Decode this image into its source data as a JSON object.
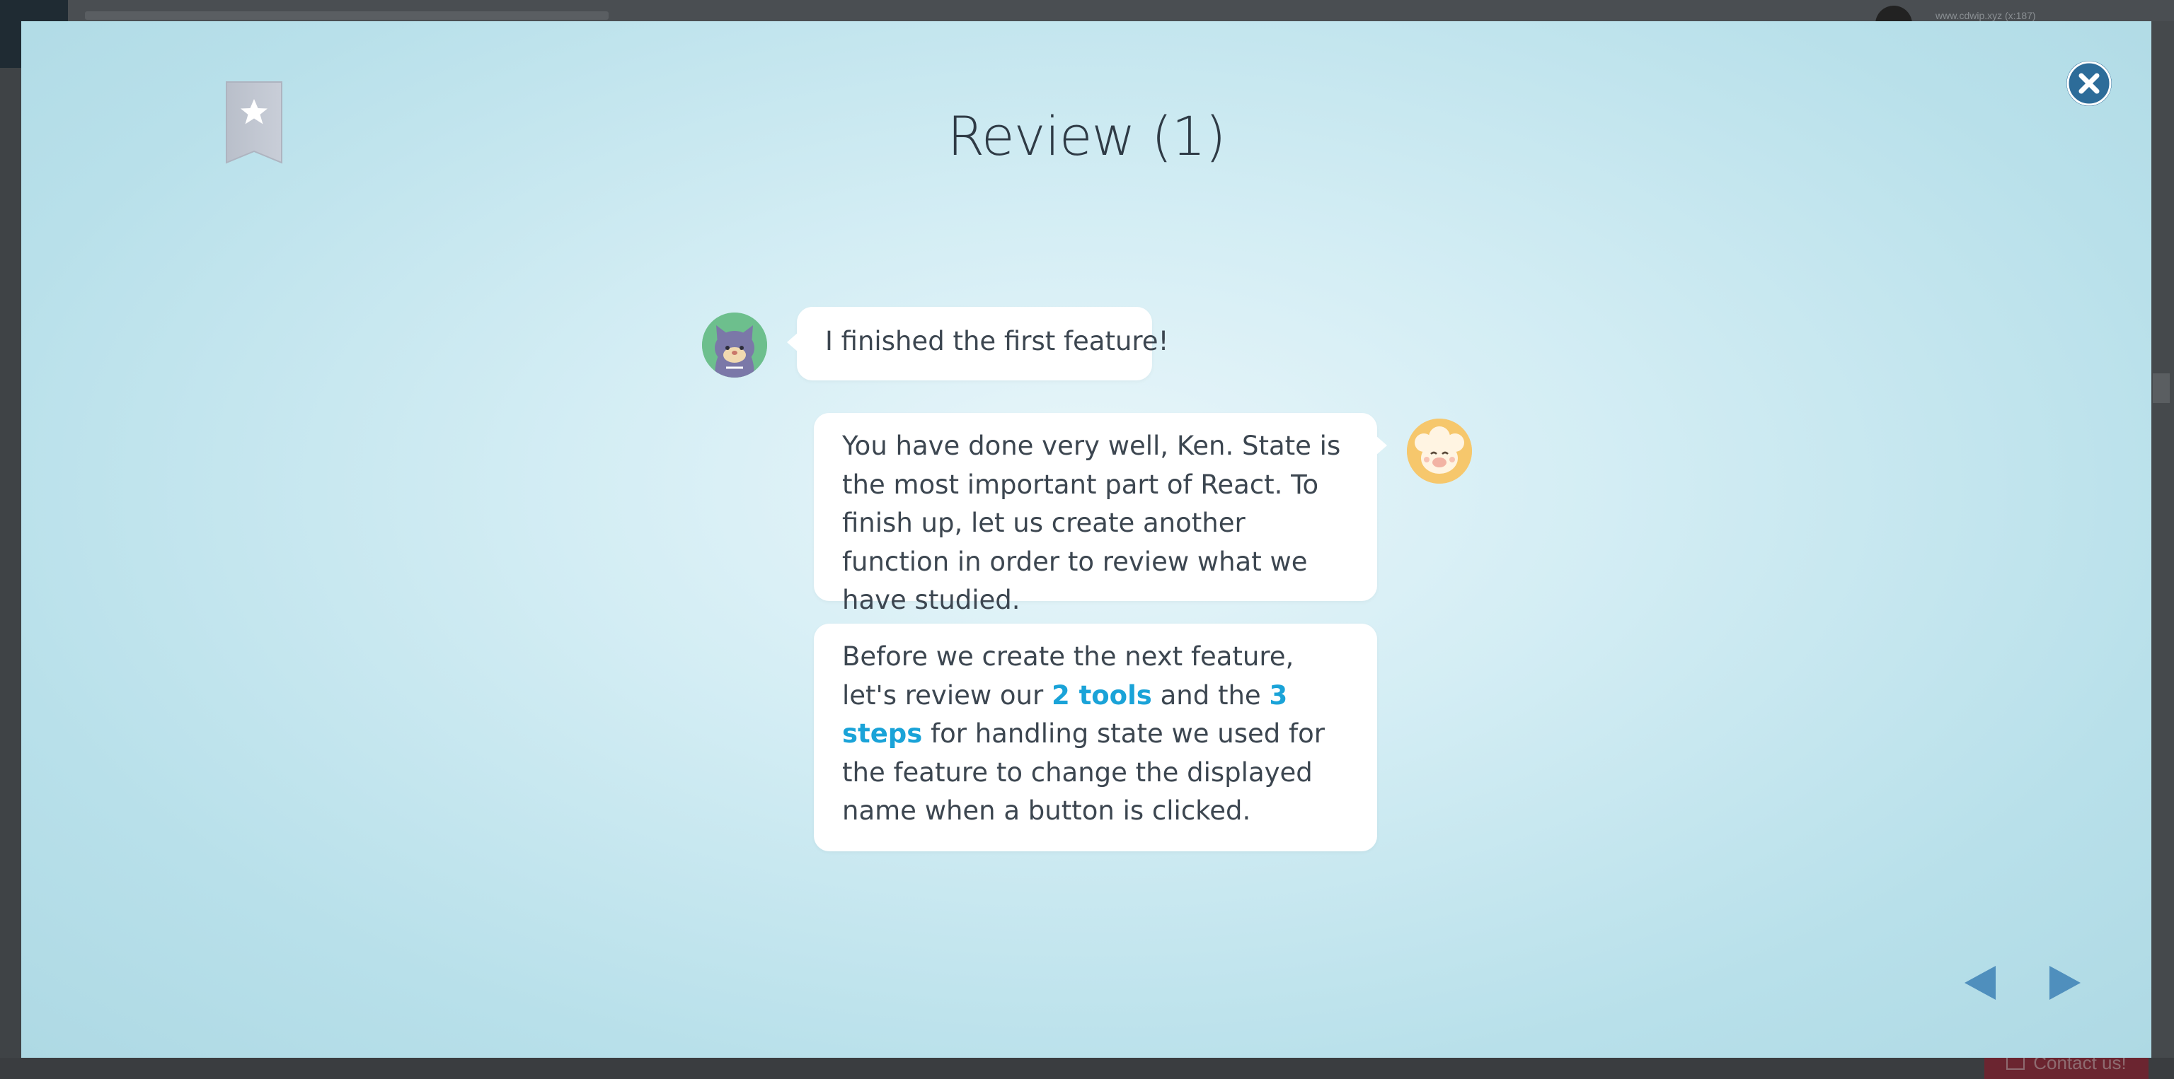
{
  "modal": {
    "title": "Review (1)",
    "close_icon": "close-icon",
    "bookmark_icon": "bookmark-star-icon"
  },
  "chat": [
    {
      "speaker": "cat-avatar",
      "text": "I finished the first feature!"
    },
    {
      "speaker": "sheep-avatar",
      "text": "You have done very well, Ken. State is the most important part of React. To finish up, let us create another function in order to review what we have studied."
    },
    {
      "speaker": "sheep-avatar",
      "parts": {
        "p1": "Before we create the next feature, let's review our ",
        "h1": "2 tools",
        "p2": " and the ",
        "h2": "3 steps",
        "p3": " for handling state we used for the feature to change the displayed name when a button is clicked."
      }
    }
  ],
  "navigation": {
    "prev_icon": "triangle-left-icon",
    "next_icon": "triangle-right-icon"
  },
  "background": {
    "contact_label": "Contact us!",
    "user_text": "www.cdwip.xyz (x:187)"
  },
  "colors": {
    "accent": "#1aa3d8",
    "close_button": "#2d6c99",
    "nav_arrow": "#4f8fbd",
    "text": "#3c4650"
  }
}
